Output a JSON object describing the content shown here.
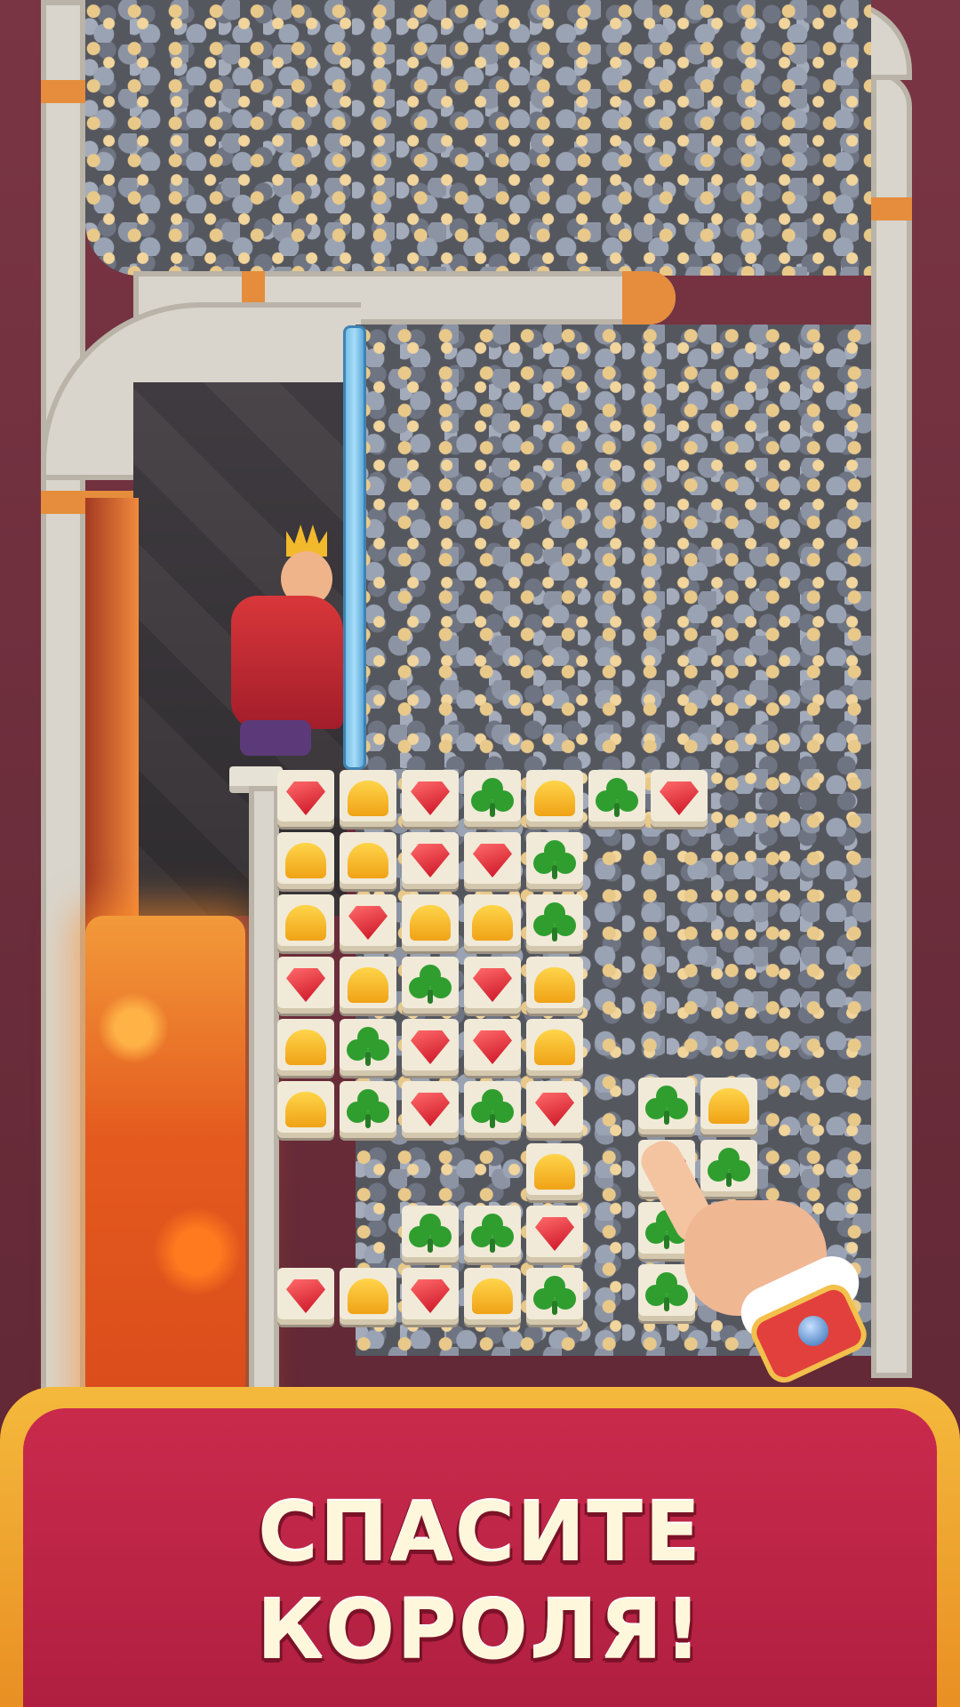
{
  "banner": {
    "line1": "СПАСИТЕ",
    "line2": "КОРОЛЯ!"
  },
  "board": {
    "rows": [
      [
        "ruby",
        "crown",
        "ruby",
        "clover",
        "crown",
        "clover",
        "ruby"
      ],
      [
        "crown",
        "crown",
        "ruby",
        "ruby",
        "clover"
      ],
      [
        "crown",
        "ruby",
        "crown",
        "crown",
        "clover"
      ],
      [
        "ruby",
        "crown",
        "clover",
        "ruby",
        "crown"
      ],
      [
        "crown",
        "clover",
        "ruby",
        "ruby",
        "crown"
      ],
      [
        "crown",
        "clover",
        "ruby",
        "clover",
        "ruby"
      ],
      [
        "",
        "",
        "",
        "",
        "crown"
      ],
      [
        "",
        "",
        "clover",
        "clover",
        "ruby"
      ],
      [
        "ruby",
        "crown",
        "ruby",
        "crown",
        "clover"
      ]
    ],
    "side_rows": [
      [
        "clover",
        "crown"
      ],
      [
        "ruby",
        "clover"
      ],
      [
        "clover",
        ""
      ],
      [
        "clover",
        ""
      ]
    ]
  },
  "colors": {
    "banner_red": "#c92a4c",
    "banner_gold": "#f4b93c",
    "lava": "#e45a1e",
    "pin_blue": "#78c0ea"
  },
  "icons": {
    "ruby": "ruby-gem-icon",
    "crown": "gold-crown-gem-icon",
    "clover": "green-clover-gem-icon",
    "hand": "pointing-hand-icon"
  }
}
